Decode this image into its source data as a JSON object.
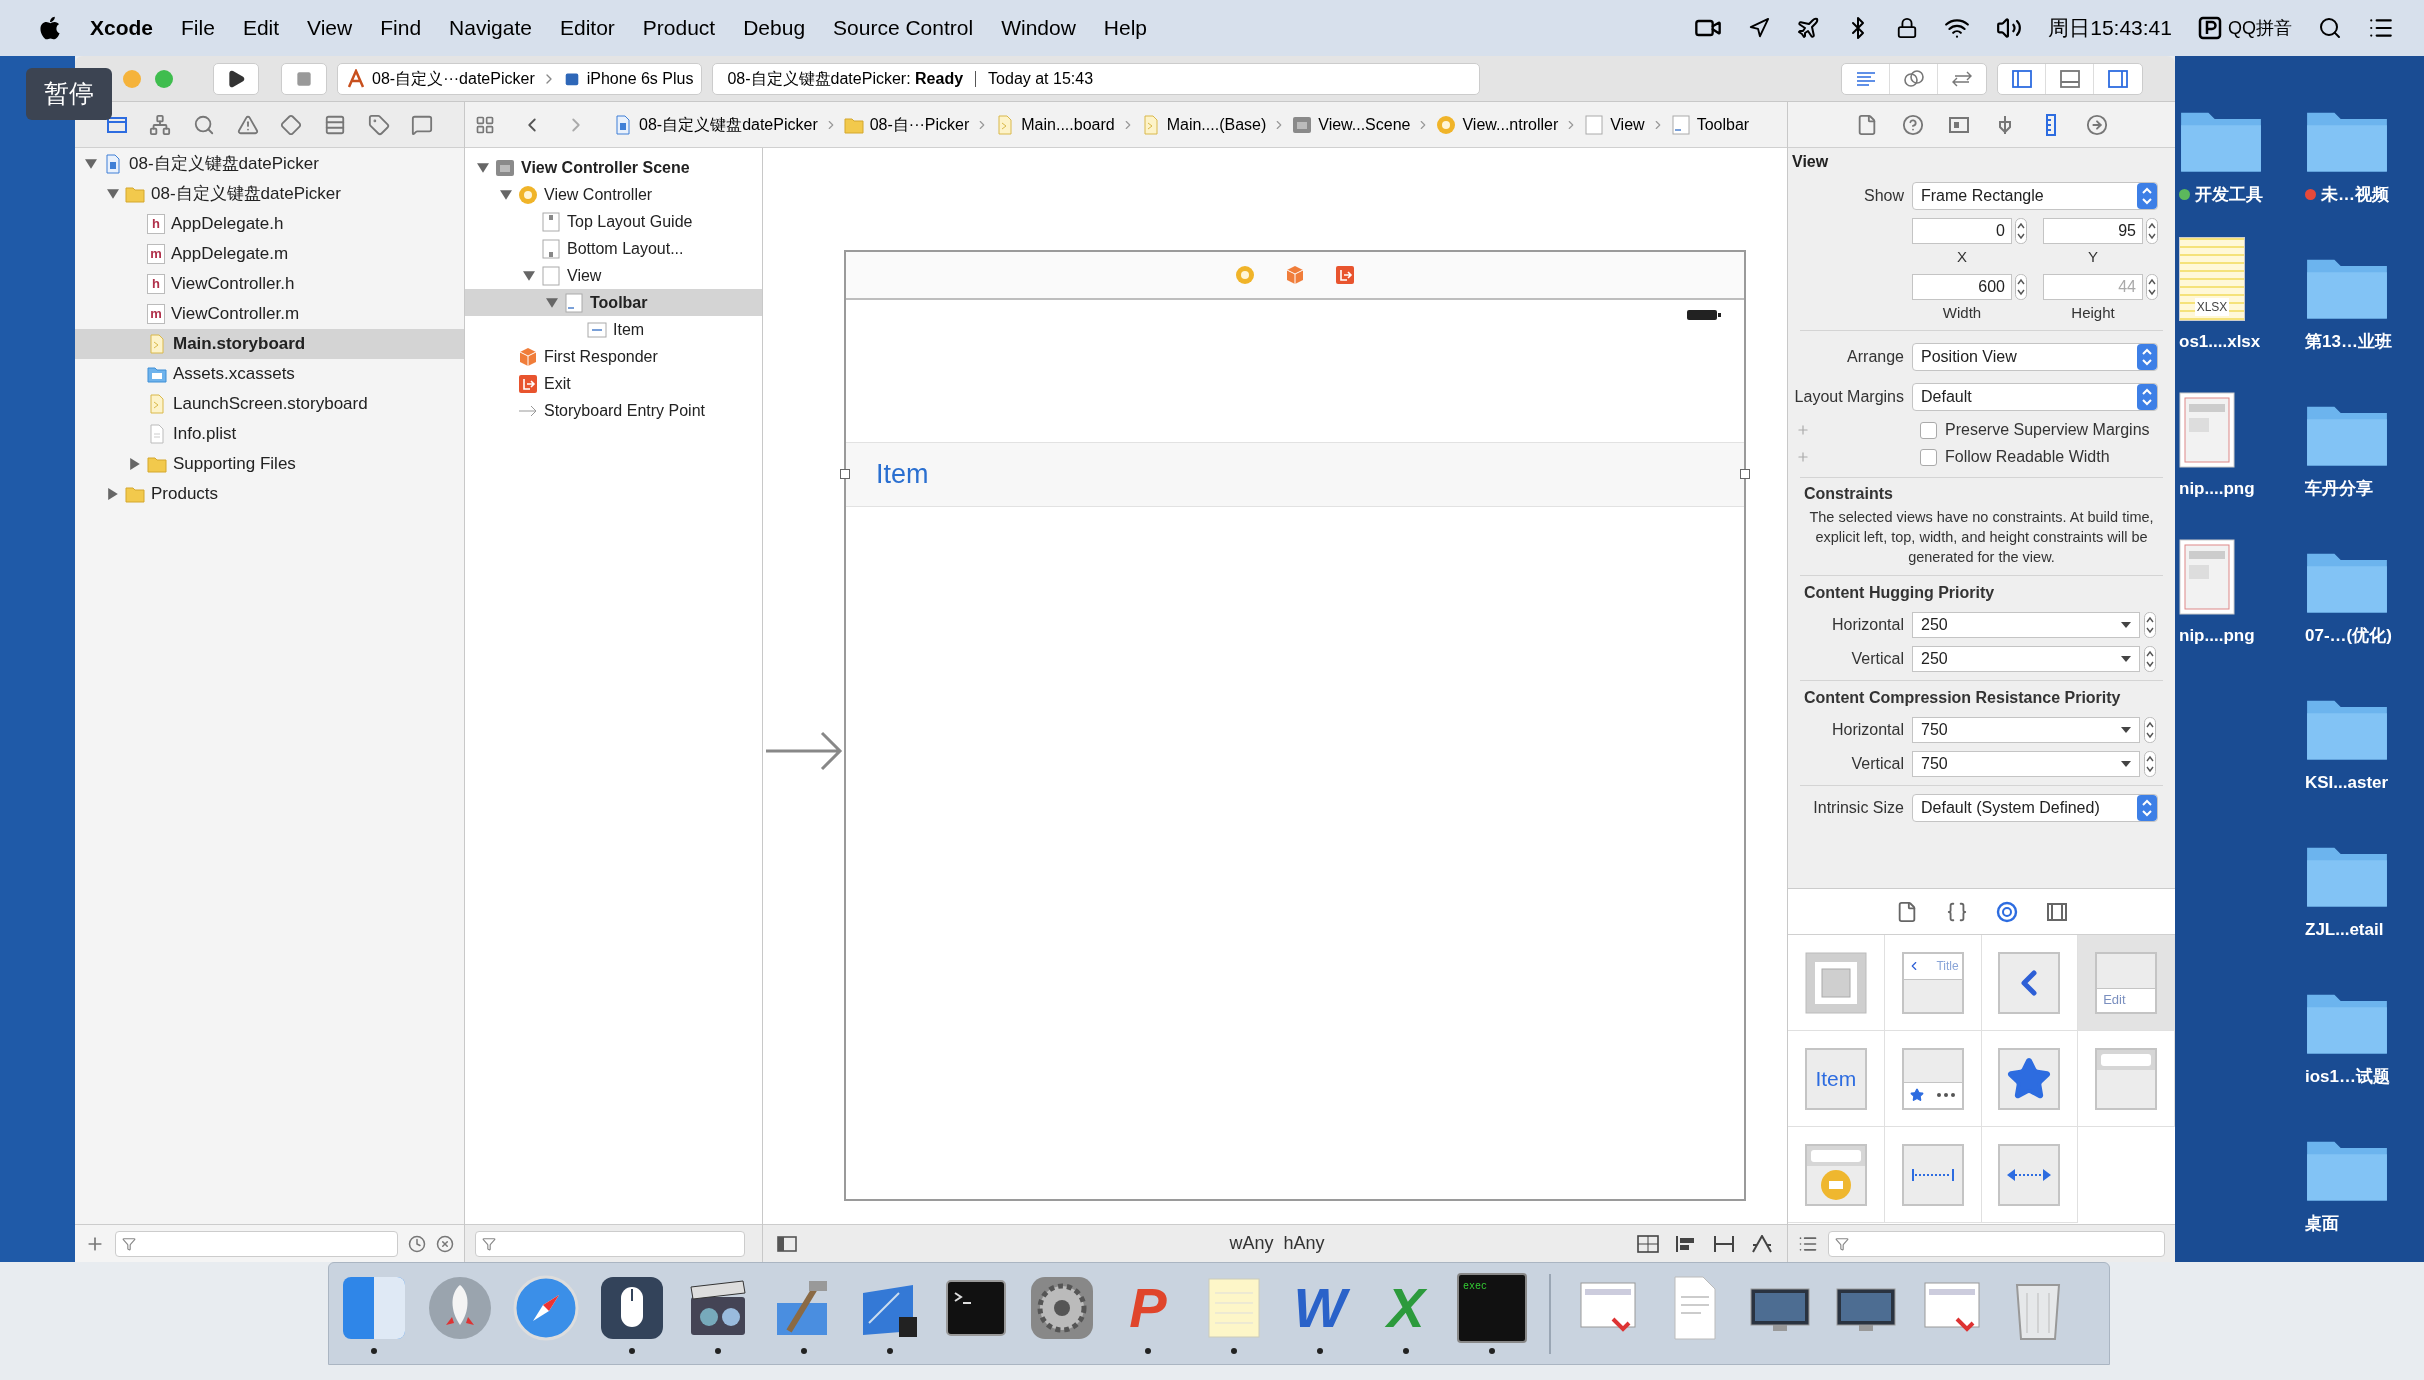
{
  "menu_bar": {
    "app": "Xcode",
    "menus": [
      "File",
      "Edit",
      "View",
      "Find",
      "Navigate",
      "Editor",
      "Product",
      "Debug",
      "Source Control",
      "Window",
      "Help"
    ],
    "clock": "周日15:43:41",
    "input_method": "QQ拼音"
  },
  "overlay_badge": "暂停",
  "toolbar": {
    "scheme": "08-自定义···datePicker",
    "device": "iPhone 6s Plus",
    "activity": "08-自定义键盘datePicker: **Ready**",
    "activity_time": "Today at 15:43"
  },
  "navigator_tabs": [
    {
      "kind": "project",
      "selected": true
    },
    {
      "kind": "symbol",
      "selected": false
    },
    {
      "kind": "find",
      "selected": false
    },
    {
      "kind": "issue",
      "selected": false
    },
    {
      "kind": "test",
      "selected": false
    },
    {
      "kind": "debug",
      "selected": false
    },
    {
      "kind": "breakpoint",
      "selected": false
    },
    {
      "kind": "report",
      "selected": false
    }
  ],
  "jump_bar": [
    {
      "kind": "project",
      "label": "08-自定义键盘datePicker"
    },
    {
      "kind": "folder",
      "label": "08-自···Picker"
    },
    {
      "kind": "storyboard",
      "label": "Main....board"
    },
    {
      "kind": "storyboard",
      "label": "Main....(Base)"
    },
    {
      "kind": "scene",
      "label": "View...Scene"
    },
    {
      "kind": "controller",
      "label": "View...ntroller"
    },
    {
      "kind": "view",
      "label": "View"
    },
    {
      "kind": "toolbar",
      "label": "Toolbar"
    }
  ],
  "inspector_tabs": [
    {
      "kind": "file",
      "selected": false
    },
    {
      "kind": "help",
      "selected": false
    },
    {
      "kind": "identity",
      "selected": false
    },
    {
      "kind": "attributes",
      "selected": false
    },
    {
      "kind": "size",
      "selected": true
    },
    {
      "kind": "connections",
      "selected": false
    }
  ],
  "project_tree": [
    {
      "name": "08-自定义键盘datePicker",
      "kind": "project",
      "expanded": true,
      "selected": false,
      "children": [
        {
          "name": "08-自定义键盘datePicker",
          "kind": "folder",
          "expanded": true,
          "selected": false,
          "children": [
            {
              "name": "AppDelegate.h",
              "kind": "source",
              "badge": "h",
              "selected": false
            },
            {
              "name": "AppDelegate.m",
              "kind": "source",
              "badge": "m",
              "selected": false
            },
            {
              "name": "ViewController.h",
              "kind": "source",
              "badge": "h",
              "selected": false
            },
            {
              "name": "ViewController.m",
              "kind": "source",
              "badge": "m",
              "selected": false
            },
            {
              "name": "Main.storyboard",
              "kind": "storyboard",
              "selected": true
            },
            {
              "name": "Assets.xcassets",
              "kind": "assets",
              "selected": false
            },
            {
              "name": "LaunchScreen.storyboard",
              "kind": "storyboard",
              "selected": false
            },
            {
              "name": "Info.plist",
              "kind": "plist",
              "selected": false
            },
            {
              "name": "Supporting Files",
              "kind": "folder",
              "expanded": false,
              "selected": false
            }
          ]
        },
        {
          "name": "Products",
          "kind": "folder",
          "expanded": false,
          "selected": false
        }
      ]
    }
  ],
  "outline_tree": [
    {
      "name": "View Controller Scene",
      "kind": "scene",
      "expanded": true,
      "selected": false,
      "children": [
        {
          "name": "View Controller",
          "kind": "controller",
          "expanded": true,
          "selected": false,
          "children": [
            {
              "name": "Top Layout Guide",
              "kind": "top_guide",
              "selected": false
            },
            {
              "name": "Bottom Layout...",
              "kind": "bottom_guide",
              "selected": false
            },
            {
              "name": "View",
              "kind": "view",
              "expanded": true,
              "selected": false,
              "children": [
                {
                  "name": "Toolbar",
                  "kind": "toolbar",
                  "expanded": true,
                  "selected": true,
                  "children": [
                    {
                      "name": "Item",
                      "kind": "item",
                      "selected": false
                    }
                  ]
                }
              ]
            }
          ]
        },
        {
          "name": "First Responder",
          "kind": "responder",
          "selected": false
        },
        {
          "name": "Exit",
          "kind": "exit",
          "selected": false
        },
        {
          "name": "Storyboard Entry Point",
          "kind": "entry",
          "selected": false
        }
      ]
    }
  ],
  "canvas": {
    "toolbar_item": "Item",
    "size_class": [
      "wAny",
      "hAny"
    ]
  },
  "inspector": {
    "section": "View",
    "show": {
      "label": "Show",
      "value": "Frame Rectangle"
    },
    "frame": [
      {
        "label": "X",
        "value": "0",
        "disabled": false
      },
      {
        "label": "Y",
        "value": "95",
        "disabled": false
      },
      {
        "label": "Width",
        "value": "600",
        "disabled": false
      },
      {
        "label": "Height",
        "value": "44",
        "disabled": true
      }
    ],
    "arrange": {
      "label": "Arrange",
      "value": "Position View"
    },
    "layout_margins": {
      "label": "Layout Margins",
      "value": "Default"
    },
    "options": [
      {
        "label": "Preserve Superview Margins",
        "checked": false
      },
      {
        "label": "Follow Readable Width",
        "checked": false
      }
    ],
    "constraints": {
      "title": "Constraints",
      "text": "The selected views have no constraints. At build time, explicit left, top, width, and height constraints will be generated for the view."
    },
    "priority_groups": [
      {
        "title": "Content Hugging Priority",
        "rows": [
          {
            "label": "Horizontal",
            "value": "250"
          },
          {
            "label": "Vertical",
            "value": "250"
          }
        ]
      },
      {
        "title": "Content Compression Resistance Priority",
        "rows": [
          {
            "label": "Horizontal",
            "value": "750"
          },
          {
            "label": "Vertical",
            "value": "750"
          }
        ]
      }
    ],
    "intrinsic": {
      "label": "Intrinsic Size",
      "value": "Default (System Defined)"
    }
  },
  "library": {
    "tabs": [
      {
        "kind": "file",
        "selected": false
      },
      {
        "kind": "code",
        "selected": false
      },
      {
        "kind": "object",
        "selected": true
      },
      {
        "kind": "media",
        "selected": false
      }
    ],
    "items": [
      {
        "kind": "view",
        "selected": false
      },
      {
        "kind": "navigation_bar",
        "label": "Title",
        "selected": false
      },
      {
        "kind": "back",
        "selected": false
      },
      {
        "kind": "toolbar",
        "label": "Edit",
        "selected": true
      },
      {
        "kind": "bar_item",
        "label": "Item",
        "selected": false
      },
      {
        "kind": "tab_bar",
        "selected": false
      },
      {
        "kind": "star",
        "selected": false
      },
      {
        "kind": "search_bar",
        "selected": false
      },
      {
        "kind": "search_display",
        "selected": false
      },
      {
        "kind": "fixed_space",
        "selected": false
      },
      {
        "kind": "flexible_space",
        "selected": false
      }
    ]
  },
  "desktop": {
    "columns": [
      [
        {
          "kind": "folder",
          "label": "开发工具",
          "color": "#5cb85c"
        },
        {
          "kind": "spreadsheet",
          "label": "os1....xlsx",
          "badge": "XLSX"
        },
        {
          "kind": "image",
          "label": "nip....png"
        },
        {
          "kind": "image",
          "label": "nip....png"
        }
      ],
      [
        {
          "kind": "folder",
          "label": "未…视频",
          "color": "#e5493a"
        },
        {
          "kind": "folder",
          "label": "第13…业班"
        },
        {
          "kind": "folder",
          "label": "车丹分享"
        },
        {
          "kind": "folder",
          "label": "07-…(优化)"
        },
        {
          "kind": "folder",
          "label": "KSI...aster"
        },
        {
          "kind": "folder",
          "label": "ZJL...etail"
        },
        {
          "kind": "folder",
          "label": "ios1…试题"
        },
        {
          "kind": "folder",
          "label": "桌面"
        }
      ]
    ]
  },
  "dock": [
    {
      "kind": "split",
      "running": true
    },
    {
      "kind": "rocket",
      "running": false
    },
    {
      "kind": "compass",
      "running": false
    },
    {
      "kind": "mouse",
      "running": true
    },
    {
      "kind": "clapper",
      "running": true
    },
    {
      "kind": "hammer",
      "running": true
    },
    {
      "kind": "blueprint",
      "running": true
    },
    {
      "kind": "terminal",
      "running": false
    },
    {
      "kind": "gear",
      "running": false
    },
    {
      "kind": "letter",
      "glyph": "P",
      "color": "#e0452b",
      "running": true
    },
    {
      "kind": "notepad",
      "running": true
    },
    {
      "kind": "letter",
      "glyph": "W",
      "color": "#2a62c9",
      "running": true
    },
    {
      "kind": "letter",
      "glyph": "X",
      "color": "#2c9a3c",
      "running": true
    },
    {
      "kind": "exec",
      "glyph": "exec",
      "running": true
    },
    {
      "kind": "separator"
    },
    {
      "kind": "document",
      "running": false
    },
    {
      "kind": "textdoc",
      "running": false
    },
    {
      "kind": "monitor",
      "running": false
    },
    {
      "kind": "monitor",
      "running": false
    },
    {
      "kind": "document",
      "running": false
    },
    {
      "kind": "trash",
      "running": false
    }
  ]
}
